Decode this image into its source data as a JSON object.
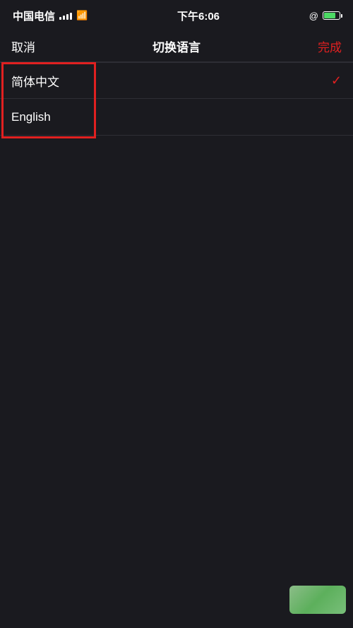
{
  "statusBar": {
    "carrier": "中国电信",
    "time": "下午6:06",
    "rightIcon": "@",
    "wifiSymbol": "WiFi"
  },
  "navBar": {
    "cancelLabel": "取消",
    "titleLabel": "切换语言",
    "doneLabel": "完成"
  },
  "languages": [
    {
      "label": "简体中文",
      "selected": true
    },
    {
      "label": "English",
      "selected": false
    }
  ],
  "colors": {
    "background": "#1a1a1f",
    "accent": "#e02020",
    "divider": "#2e2e35",
    "text": "#ffffff",
    "batteryGreen": "#4cd964"
  }
}
